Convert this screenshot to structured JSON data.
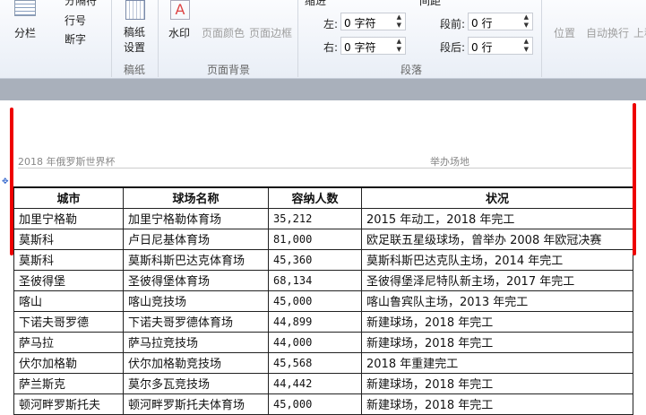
{
  "ribbon": {
    "columns_label": "分栏",
    "breaks_label": "分隔符",
    "line_numbers_label": "行号",
    "hyphenation_label": "断字",
    "manuscript_setup_label": "稿纸设置",
    "manuscript_group": "稿纸",
    "watermark_label": "水印",
    "page_color_label": "页面颜色",
    "page_borders_label": "页面边框",
    "page_background_group": "页面背景",
    "indent_label": "缩进",
    "indent_left_label": "左:",
    "indent_left_value": "0 字符",
    "indent_right_label": "右:",
    "indent_right_value": "0 字符",
    "spacing_label": "间距",
    "spacing_before_label": "段前:",
    "spacing_before_value": "0 行",
    "spacing_after_label": "段后:",
    "spacing_after_value": "0 行",
    "paragraph_group": "段落",
    "position_label": "位置",
    "wrap_text_label": "自动换行",
    "bring_forward_label": "上移"
  },
  "document": {
    "header_left": "2018 年俄罗斯世界杯",
    "header_right": "举办场地",
    "table": {
      "columns": [
        "城市",
        "球场名称",
        "容纳人数",
        "状况"
      ],
      "rows": [
        [
          "加里宁格勒",
          "加里宁格勒体育场",
          "35,212",
          "2015 年动工，2018 年完工"
        ],
        [
          "莫斯科",
          "卢日尼基体育场",
          "81,000",
          "欧足联五星级球场，曾举办 2008 年欧冠决赛"
        ],
        [
          "莫斯科",
          "莫斯科斯巴达克体育场",
          "45,360",
          "莫斯科斯巴达克队主场，2014 年完工"
        ],
        [
          "圣彼得堡",
          "圣彼得堡体育场",
          "68,134",
          "圣彼得堡泽尼特队新主场，2017 年完工"
        ],
        [
          "喀山",
          "喀山竞技场",
          "45,000",
          "喀山鲁宾队主场，2013 年完工"
        ],
        [
          "下诺夫哥罗德",
          "下诺夫哥罗德体育场",
          "44,899",
          "新建球场，2018 年完工"
        ],
        [
          "萨马拉",
          "萨马拉竞技场",
          "44,000",
          "新建球场，2018 年完工"
        ],
        [
          "伏尔加格勒",
          "伏尔加格勒竞技场",
          "45,568",
          "2018 年重建完工"
        ],
        [
          "萨兰斯克",
          "莫尔多瓦竞技场",
          "44,442",
          "新建球场，2018 年完工"
        ],
        [
          "顿河畔罗斯托夫",
          "顿河畔罗斯托夫体育场",
          "45,000",
          "新建球场，2018 年完工"
        ]
      ]
    }
  },
  "colors": {
    "annotation_red": "#e00000",
    "ribbon_bg": "#e9eef6"
  }
}
